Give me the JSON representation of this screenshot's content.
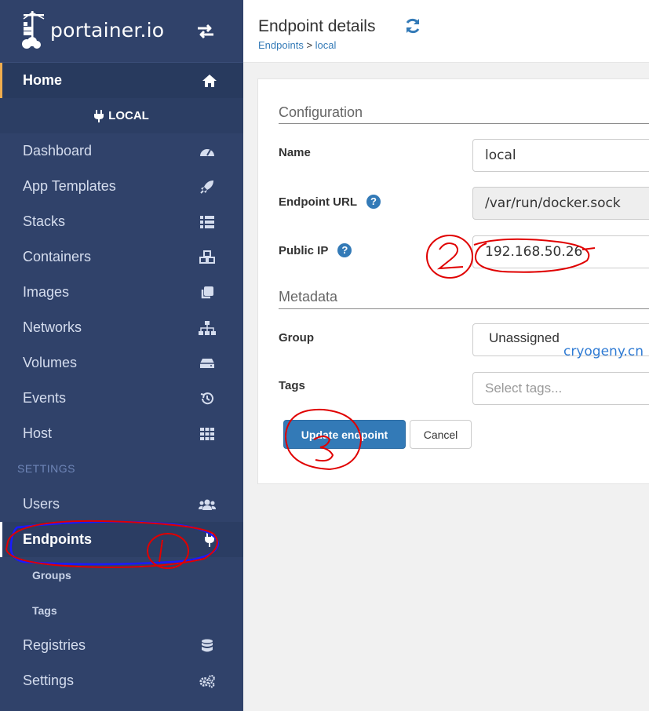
{
  "brand": {
    "name": "portainer.io"
  },
  "sidebar": {
    "home_label": "Home",
    "endpoint_name": "LOCAL",
    "items": [
      {
        "label": "Dashboard",
        "icon": "tachometer-icon"
      },
      {
        "label": "App Templates",
        "icon": "rocket-icon"
      },
      {
        "label": "Stacks",
        "icon": "th-list-icon"
      },
      {
        "label": "Containers",
        "icon": "cubes-icon"
      },
      {
        "label": "Images",
        "icon": "clone-icon"
      },
      {
        "label": "Networks",
        "icon": "sitemap-icon"
      },
      {
        "label": "Volumes",
        "icon": "hdd-icon"
      },
      {
        "label": "Events",
        "icon": "history-icon"
      },
      {
        "label": "Host",
        "icon": "th-icon"
      }
    ],
    "settings_title": "SETTINGS",
    "settings_items": {
      "users": "Users",
      "endpoints": "Endpoints",
      "groups": "Groups",
      "tags": "Tags",
      "registries": "Registries",
      "settings": "Settings"
    }
  },
  "header": {
    "title": "Endpoint details",
    "breadcrumb_root": "Endpoints",
    "breadcrumb_separator": " > ",
    "breadcrumb_current": "local"
  },
  "form": {
    "configuration_title": "Configuration",
    "name_label": "Name",
    "name_value": "local",
    "url_label": "Endpoint URL",
    "url_value": "/var/run/docker.sock",
    "public_ip_label": "Public IP",
    "public_ip_value": "192.168.50.26",
    "metadata_title": "Metadata",
    "group_label": "Group",
    "group_value": "Unassigned",
    "tags_label": "Tags",
    "tags_placeholder": "Select tags...",
    "update_button": "Update endpoint",
    "cancel_button": "Cancel"
  },
  "watermark": "cryogeny.cn",
  "colors": {
    "sidebar_bg": "#30426a",
    "primary": "#337ab7",
    "annotation_red": "#e00000",
    "annotation_blue": "#1a1aff"
  }
}
